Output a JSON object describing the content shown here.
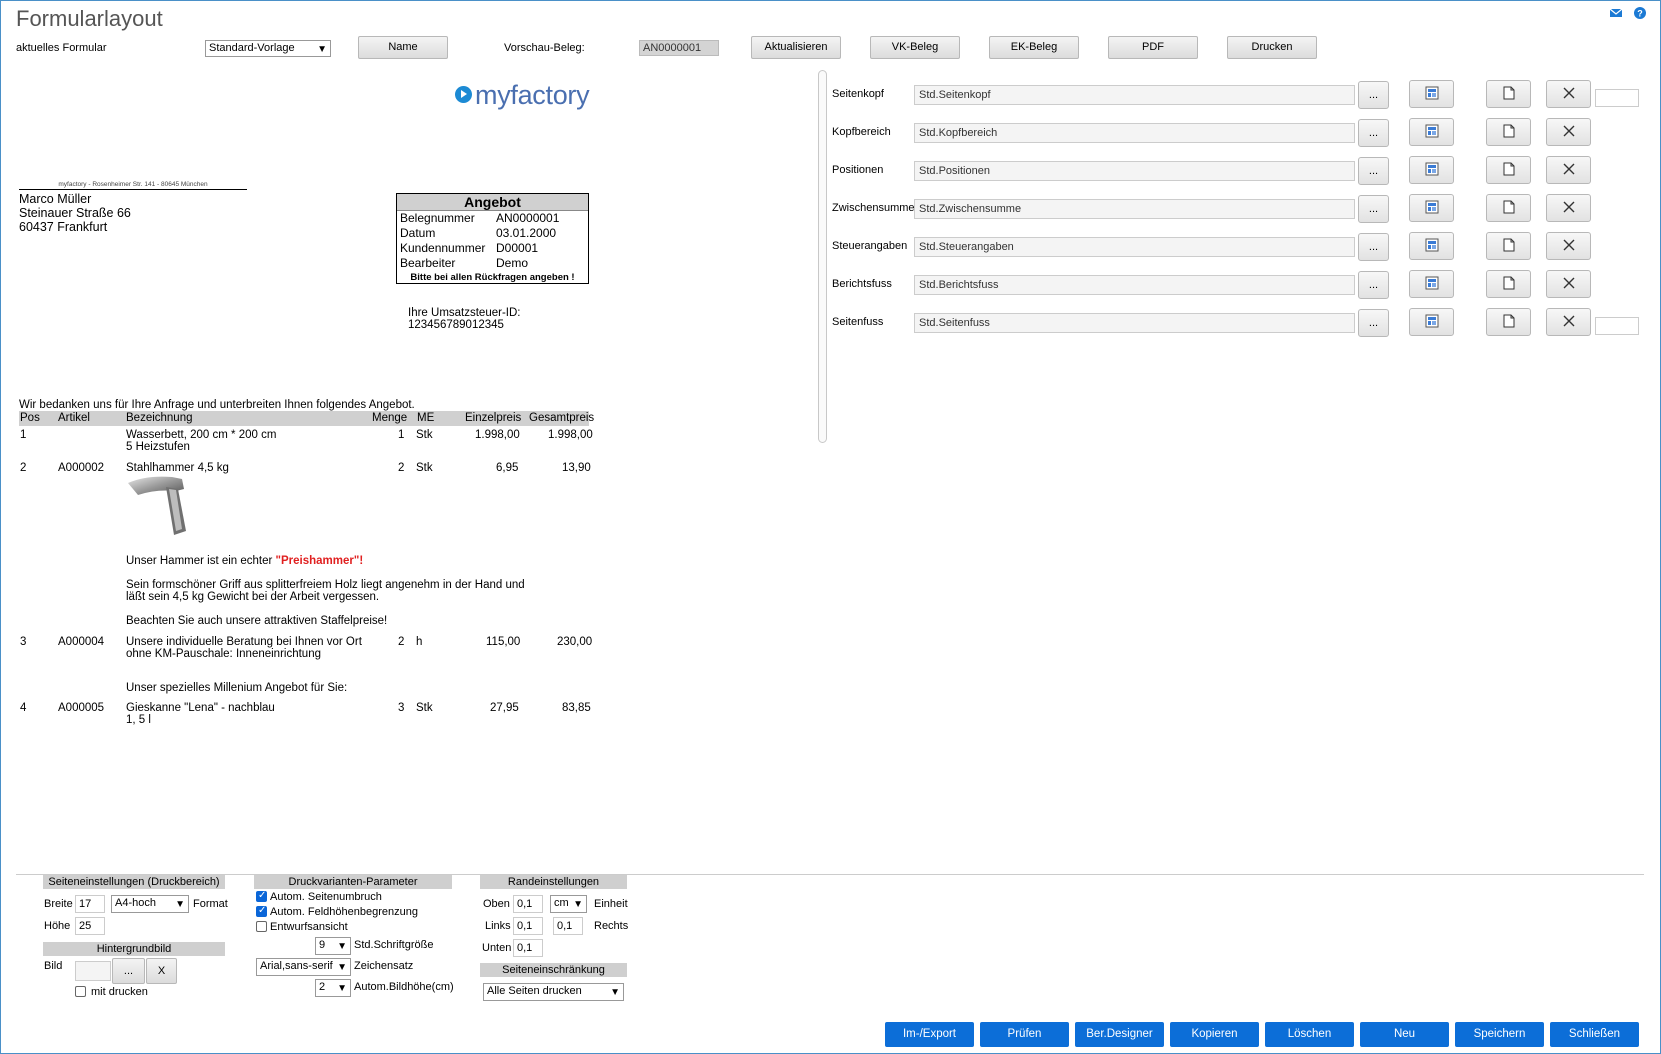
{
  "header": {
    "title": "Formularlayout",
    "label_current_form": "aktuelles Formular",
    "form_select": "Standard-Vorlage",
    "name_button": "Name",
    "preview_label": "Vorschau-Beleg:",
    "preview_value": "AN0000001",
    "buttons": [
      "Aktualisieren",
      "VK-Beleg",
      "EK-Beleg",
      "PDF",
      "Drucken"
    ],
    "icons": [
      "mail-icon",
      "help-icon"
    ]
  },
  "preview": {
    "logo": "myfactory",
    "sender_line": "myfactory - Rosenheimer Str. 141 - 80645 München",
    "address": [
      "Marco Müller",
      "Steinauer Straße 66",
      "60437 Frankfurt"
    ],
    "box": {
      "title": "Angebot",
      "rows": [
        {
          "k": "Belegnummer",
          "v": "AN0000001"
        },
        {
          "k": "Datum",
          "v": "03.01.2000"
        },
        {
          "k": "Kundennummer",
          "v": "D00001"
        },
        {
          "k": "Bearbeiter",
          "v": "Demo"
        }
      ],
      "footer": "Bitte bei allen Rückfragen angeben !"
    },
    "ustid_label": "Ihre Umsatzsteuer-ID:",
    "ustid_value": "123456789012345",
    "intro": "Wir bedanken uns für Ihre Anfrage und unterbreiten Ihnen folgendes Angebot.",
    "columns": [
      "Pos",
      "Artikel",
      "Bezeichnung",
      "Menge",
      "ME",
      "Einzelpreis",
      "Gesamtpreis"
    ],
    "positions": [
      {
        "pos": "1",
        "artikel": "",
        "bez": "Wasserbett, 200 cm * 200 cm",
        "bez2": "5 Heizstufen",
        "menge": "1",
        "me": "Stk",
        "ep": "1.998,00",
        "gp": "1.998,00"
      },
      {
        "pos": "2",
        "artikel": "A000002",
        "bez": "Stahlhammer 4,5 kg",
        "bez2": "",
        "menge": "2",
        "me": "Stk",
        "ep": "6,95",
        "gp": "13,90"
      },
      {
        "pos": "3",
        "artikel": "A000004",
        "bez": "Unsere individuelle Beratung bei Ihnen vor Ort",
        "bez2": "ohne KM-Pauschale: Inneneinrichtung",
        "menge": "2",
        "me": "h",
        "ep": "115,00",
        "gp": "230,00"
      },
      {
        "pos": "4",
        "artikel": "A000005",
        "bez": "Gieskanne \"Lena\" - nachblau",
        "bez2": "1, 5 l",
        "menge": "3",
        "me": "Stk",
        "ep": "27,95",
        "gp": "83,85"
      }
    ],
    "hammer_text_prefix": "Unser Hammer ist ein echter ",
    "hammer_text_highlight": "\"Preishammer\"!",
    "hammer_desc1": "Sein formschöner Griff aus splitterfreiem Holz liegt angenehm in der Hand und",
    "hammer_desc2": "läßt sein 4,5 kg Gewicht bei der Arbeit vergessen.",
    "hammer_desc3": "Beachten Sie auch unsere attraktiven Staffelpreise!",
    "millenium": "Unser spezielles Millenium Angebot für Sie:"
  },
  "sections": [
    {
      "label": "Seitenkopf",
      "value": "Std.Seitenkopf"
    },
    {
      "label": "Kopfbereich",
      "value": "Std.Kopfbereich"
    },
    {
      "label": "Positionen",
      "value": "Std.Positionen"
    },
    {
      "label": "Zwischensumme",
      "value": "Std.Zwischensumme"
    },
    {
      "label": "Steuerangaben",
      "value": "Std.Steuerangaben"
    },
    {
      "label": "Berichtsfuss",
      "value": "Std.Berichtsfuss"
    },
    {
      "label": "Seitenfuss",
      "value": "Std.Seitenfuss"
    }
  ],
  "settings": {
    "page_group": "Seiteneinstellungen (Druckbereich)",
    "breite_label": "Breite",
    "breite_value": "17",
    "format_select": "A4-hoch",
    "format_label": "Format",
    "hoehe_label": "Höhe",
    "hoehe_value": "25",
    "bg_group": "Hintergrundbild",
    "bild_label": "Bild",
    "bild_browse": "...",
    "bild_clear": "X",
    "mitdrucken": "mit drucken",
    "druck_group": "Druckvarianten-Parameter",
    "cb1": "Autom. Seitenumbruch",
    "cb2": "Autom. Feldhöhenbegrenzung",
    "cb3": "Entwurfsansicht",
    "fontsize_value": "9",
    "fontsize_label": "Std.Schriftgröße",
    "font_value": "Arial,sans-serif",
    "font_label": "Zeichensatz",
    "imgh_value": "2",
    "imgh_label": "Autom.Bildhöhe(cm)",
    "rand_group": "Randeinstellungen",
    "oben_label": "Oben",
    "oben_value": "0,1",
    "unit_value": "cm",
    "unit_label": "Einheit",
    "links_label": "Links",
    "links_value": "0,1",
    "rechts_value": "0,1",
    "rechts_label": "Rechts",
    "unten_label": "Unten",
    "unten_value": "0,1",
    "restrict_group": "Seiteneinschränkung",
    "restrict_value": "Alle Seiten drucken"
  },
  "footer_buttons": [
    "Im-/Export",
    "Prüfen",
    "Ber.Designer",
    "Kopieren",
    "Löschen",
    "Neu",
    "Speichern",
    "Schließen"
  ],
  "colors": {
    "primary_button": "#0c6ed8",
    "highlight_text": "#e02020",
    "logo_dot": "#1c8ad4"
  }
}
